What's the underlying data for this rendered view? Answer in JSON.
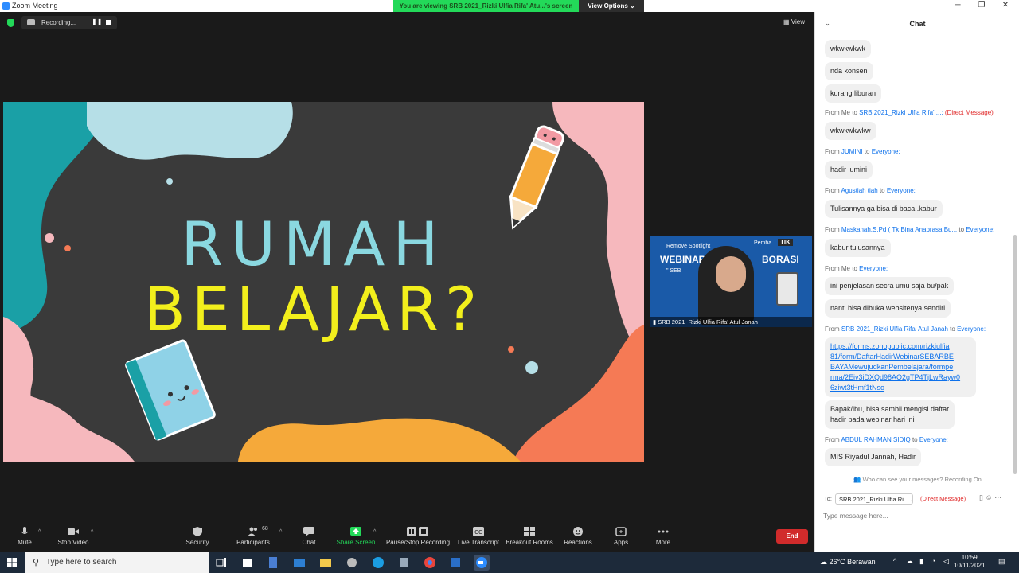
{
  "titlebar": {
    "title": "Zoom Meeting",
    "minimize": "─",
    "maximize": "❐",
    "close": "✕"
  },
  "share_banner": "You are viewing SRB 2021_Rizki Ulfia Rifa' Atu...'s screen",
  "view_options": "View Options ⌄",
  "recording": {
    "label": "Recording...",
    "pause_glyph": "❚❚"
  },
  "view_button": "View",
  "slide": {
    "line1": "RUMAH",
    "line2": "BELAJAR?",
    "colors": {
      "board": "#3a3a3a",
      "line1": "#8ad8e0",
      "line2": "#f2ef1c",
      "teal": "#1aa0a6",
      "pink": "#f6b8bd",
      "orange": "#f5a93a",
      "coral": "#f57a55",
      "lightblue": "#b6dfe7"
    }
  },
  "thumbnail": {
    "name": "SRB 2021_Rizki Ulfia Rifa' Atul Janah",
    "overlay": "Remove Spotlight",
    "banner_left": "WEBINAR",
    "banner_right": "BORASI",
    "banner_sub": "\" SEB",
    "pemba": "Pemba",
    "tik": "TIK"
  },
  "toolbar": {
    "items": [
      {
        "id": "mute",
        "label": "Mute",
        "icon": "microphone-icon"
      },
      {
        "id": "stop-video",
        "label": "Stop Video",
        "icon": "video-camera-icon"
      },
      {
        "id": "security",
        "label": "Security",
        "icon": "shield-icon"
      },
      {
        "id": "participants",
        "label": "Participants",
        "icon": "participants-icon",
        "count": "68"
      },
      {
        "id": "chat",
        "label": "Chat",
        "icon": "chat-bubble-icon"
      },
      {
        "id": "share-screen",
        "label": "Share Screen",
        "icon": "share-screen-icon"
      },
      {
        "id": "pause-stop-recording",
        "label": "Pause/Stop Recording",
        "icon": "pause-stop-icon"
      },
      {
        "id": "live-transcript",
        "label": "Live Transcript",
        "icon": "cc-icon"
      },
      {
        "id": "breakout-rooms",
        "label": "Breakout Rooms",
        "icon": "grid-icon"
      },
      {
        "id": "reactions",
        "label": "Reactions",
        "icon": "smiley-plus-icon"
      },
      {
        "id": "apps",
        "label": "Apps",
        "icon": "apps-icon"
      },
      {
        "id": "more",
        "label": "More",
        "icon": "ellipsis-icon"
      }
    ],
    "end": "End",
    "share_color": "#23d959"
  },
  "chat": {
    "title": "Chat",
    "messages": [
      {
        "text": "wkwkwkwk"
      },
      {
        "text": "nda konsen"
      },
      {
        "text": "kurang liburan"
      },
      {
        "from_prefix": "From Me to ",
        "who": "SRB 2021_Rizki Ulfia Rifa' ...:",
        "dm": " (Direct Message)",
        "text": "wkwkwkwkw"
      },
      {
        "from_prefix": "From ",
        "who": "JUMINI",
        "to": " to ",
        "audience": "Everyone:",
        "text": "hadir jumini"
      },
      {
        "from_prefix": "From ",
        "who": "Agustiah tiah",
        "to": " to ",
        "audience": "Everyone:",
        "text": "Tulisannya ga bisa di baca..kabur"
      },
      {
        "from_prefix": "From ",
        "who": "Maskanah,S.Pd ( Tk Bina Anaprasa Bu...",
        "to": " to ",
        "audience": "Everyone:",
        "text": "kabur tulusannya"
      },
      {
        "from_prefix": "From Me to ",
        "who": "",
        "to": "",
        "audience": "Everyone:",
        "text": "ini  penjelasan secra umu saja bu/pak"
      },
      {
        "text": "nanti bisa dibuka websitenya sendiri"
      },
      {
        "from_prefix": "From ",
        "who": "SRB 2021_Rizki Ulfia Rifa' Atul Janah",
        "to": " to ",
        "audience": "Everyone:",
        "link_lines": [
          "https://forms.zohopublic.com/rizkiulfia",
          "81/form/DaftarHadirWebinarSEBARBE",
          "BAYAMewujudkanPembelajara/formpe",
          "rma/2Eiv3iDXQd98AO2gTP4TjLwRayw0",
          "6ziwt3tHmf1tNso"
        ]
      },
      {
        "text_lines": [
          "Bapak/ibu, bisa sambil mengisi daftar",
          "hadir pada webinar hari ini"
        ]
      },
      {
        "from_prefix": "From ",
        "who": "ABDUL RAHMAN SIDIQ",
        "to": " to ",
        "audience": "Everyone:",
        "text": "MIS Riyadul Jannah, Hadir"
      }
    ],
    "privacy": "Who can see your messages? Recording On",
    "to_label": "To:",
    "to_value": "SRB 2021_Rizki Ulfia Ri...",
    "to_dm": "(Direct Message)",
    "input_placeholder": "Type message here..."
  },
  "taskbar": {
    "search_placeholder": "Type here to search",
    "weather": "26°C  Berawan",
    "time": "10:59",
    "date": "10/11/2021"
  }
}
